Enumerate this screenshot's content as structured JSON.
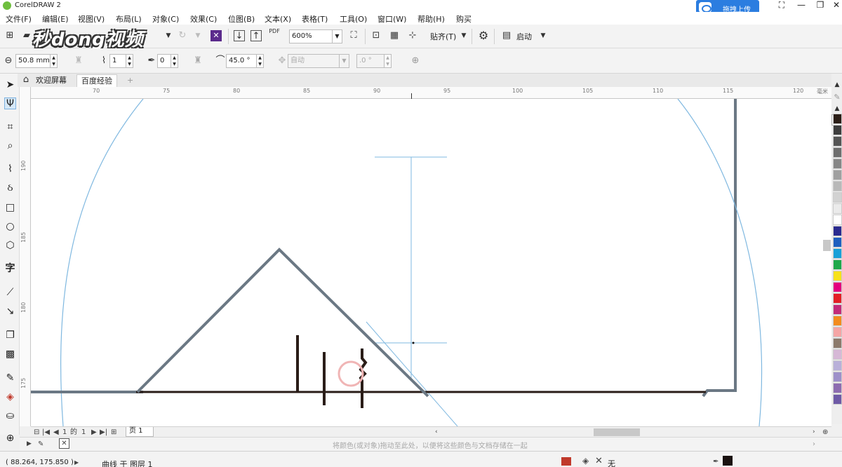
{
  "window": {
    "title": "CorelDRAW 2",
    "upload_label": "拖拽上传"
  },
  "menu": [
    "文件(F)",
    "编辑(E)",
    "视图(V)",
    "布局(L)",
    "对象(C)",
    "效果(C)",
    "位图(B)",
    "文本(X)",
    "表格(T)",
    "工具(O)",
    "窗口(W)",
    "帮助(H)",
    "购买"
  ],
  "toolbar1": {
    "zoom": "600%",
    "snap_label": "贴齐(T)",
    "launch_label": "启动",
    "pdf_label": "PDF"
  },
  "toolbar2": {
    "size": "50.8 mm",
    "nodes": "1",
    "outline_value": "0",
    "angle": "45.0 °",
    "auto": "自动",
    "rotation": ".0 °"
  },
  "watermark": "秒dong视频",
  "tabs": [
    {
      "label": "欢迎屏幕",
      "active": false
    },
    {
      "label": "百度经验",
      "active": true
    }
  ],
  "ruler": {
    "h_labels": [
      "70",
      "75",
      "80",
      "85",
      "90",
      "95",
      "100",
      "105",
      "110",
      "115",
      "120"
    ],
    "v_labels": [
      "190",
      "185",
      "180",
      "175"
    ],
    "unit": "毫米"
  },
  "pager": {
    "current": "1",
    "of_label": "的",
    "total": "1",
    "page_tab": "页 1"
  },
  "colorbar": {
    "hint": "将颜色(或对象)拖动至此处，以便将这些颜色与文档存储在一起"
  },
  "status": {
    "coords": "( 88.264, 175.850 )",
    "layer_info": "曲线 于 图层 1",
    "fill_label": "无"
  },
  "palette_colors": [
    "#2b1e17",
    "#3d3d3d",
    "#555555",
    "#6e6e6e",
    "#878787",
    "#a0a0a0",
    "#b9b9b9",
    "#d2d2d2",
    "#ebebeb",
    "#ffffff",
    "#2a2a8f",
    "#1f5fbf",
    "#18a0d8",
    "#1ea84a",
    "#f7e11a",
    "#e3007e",
    "#e31f26",
    "#c22b7a",
    "#f28c1e",
    "#f5a5a5",
    "#8c7a6c",
    "#d6b8d6",
    "#b9b0d9",
    "#9d90c9",
    "#8d6cb0",
    "#6e5aa6"
  ]
}
